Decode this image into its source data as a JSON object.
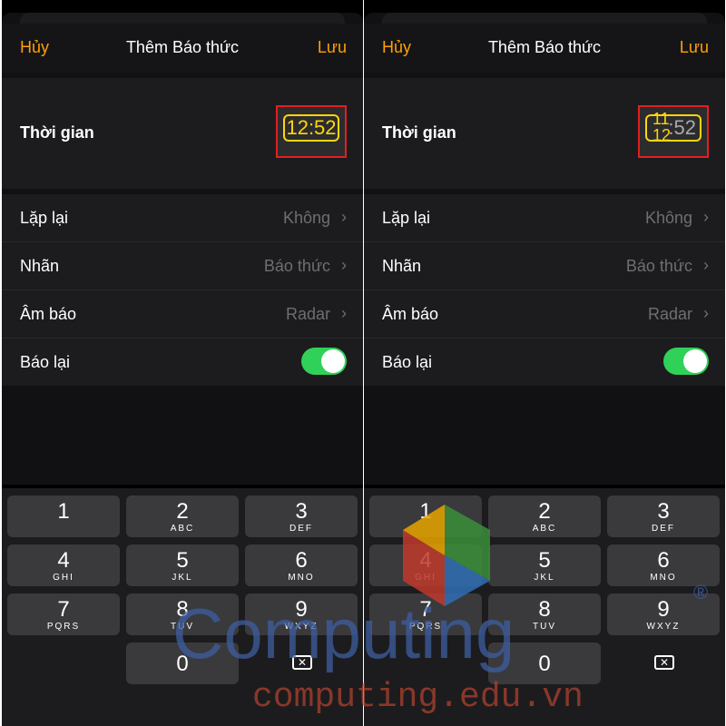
{
  "nav": {
    "cancel": "Hủy",
    "title": "Thêm Báo thức",
    "save": "Lưu"
  },
  "time": {
    "label": "Thời gian",
    "value": "12:52",
    "hour_prev": "11",
    "hour": "12",
    "minute": ":52"
  },
  "settings": [
    {
      "label": "Lặp lại",
      "value": "Không"
    },
    {
      "label": "Nhãn",
      "value": "Báo thức"
    },
    {
      "label": "Âm báo",
      "value": "Radar"
    }
  ],
  "snooze": {
    "label": "Báo lại",
    "on": true
  },
  "keypad": [
    {
      "num": "1",
      "letters": ""
    },
    {
      "num": "2",
      "letters": "ABC"
    },
    {
      "num": "3",
      "letters": "DEF"
    },
    {
      "num": "4",
      "letters": "GHI"
    },
    {
      "num": "5",
      "letters": "JKL"
    },
    {
      "num": "6",
      "letters": "MNO"
    },
    {
      "num": "7",
      "letters": "PQRS"
    },
    {
      "num": "8",
      "letters": "TUV"
    },
    {
      "num": "9",
      "letters": "WXYZ"
    },
    {
      "num": "0",
      "letters": ""
    }
  ],
  "watermark": {
    "brand": "Computing",
    "registered": "®",
    "url": "computing.edu.vn"
  },
  "colors": {
    "accent": "#ff9f0a",
    "toggle_on": "#30d158",
    "highlight": "#e02020",
    "picker": "#ffd60a"
  }
}
